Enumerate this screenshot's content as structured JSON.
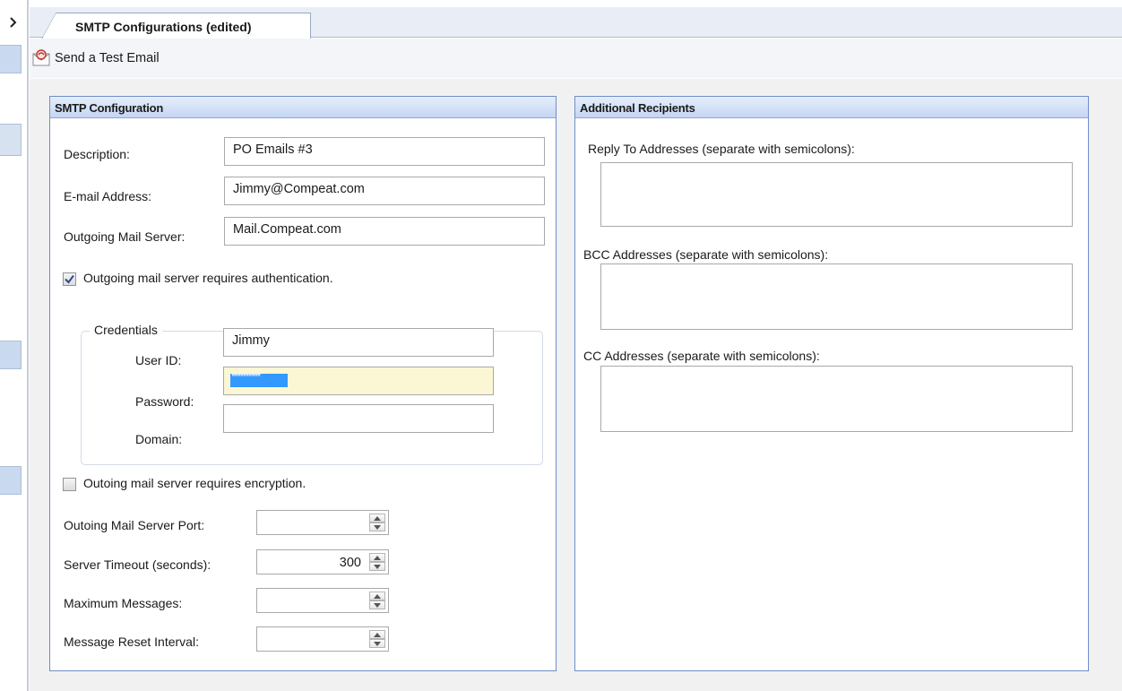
{
  "tab": {
    "title": "SMTP Configurations (edited)"
  },
  "toolbar": {
    "test_email_label": "Send a Test Email",
    "test_email_icon": "email-envelope-icon"
  },
  "smtp": {
    "header": "SMTP Configuration",
    "description_label": "Description:",
    "description_value": "PO Emails #3",
    "email_label": "E-mail Address:",
    "email_value": "Jimmy@Compeat.com",
    "server_label": "Outgoing Mail Server:",
    "server_value": "Mail.Compeat.com",
    "auth_label": "Outgoing mail server requires authentication.",
    "auth_checked": true,
    "credentials": {
      "title": "Credentials",
      "userid_label": "User ID:",
      "userid_value": "Jimmy",
      "password_label": "Password:",
      "password_value": "**********",
      "domain_label": "Domain:",
      "domain_value": ""
    },
    "encryption_label": "Outoing mail server requires encryption.",
    "encryption_checked": false,
    "port_label": "Outoing Mail Server Port:",
    "port_value": "",
    "timeout_label": "Server Timeout (seconds):",
    "timeout_value": "300",
    "max_messages_label": "Maximum Messages:",
    "max_messages_value": "",
    "reset_interval_label": "Message Reset Interval:",
    "reset_interval_value": ""
  },
  "recipients": {
    "header": "Additional Recipients",
    "reply_to_label": "Reply To Addresses (separate with semicolons):",
    "bcc_label": "BCC Addresses (separate with semicolons):",
    "cc_label": "CC Addresses (separate with semicolons):"
  },
  "colors": {
    "panel_border": "#6f8fc8",
    "panel_header_bg": "#c4d6f2",
    "password_field_bg": "#fbf7d5",
    "selection_blue": "#3399ff"
  }
}
